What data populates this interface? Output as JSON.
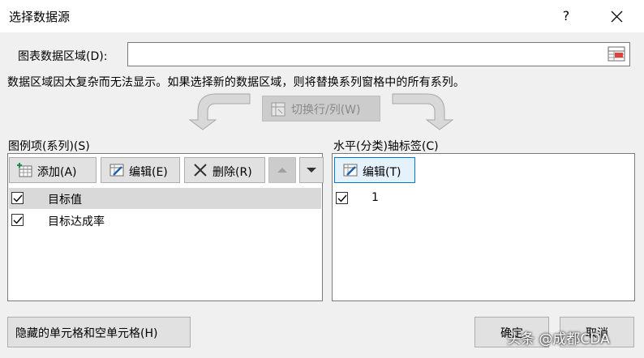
{
  "dialog": {
    "title": "选择数据源",
    "help": "?"
  },
  "range": {
    "label": "图表数据区域(D):",
    "value": ""
  },
  "notice": "数据区域因太复杂而无法显示。如果选择新的数据区域，则将替换系列窗格中的所有系列。",
  "switch_button": "切换行/列(W)",
  "legend": {
    "label": "图例项(系列)(S)",
    "add": "添加(A)",
    "edit": "编辑(E)",
    "delete": "删除(R)",
    "series": [
      {
        "name": "目标值",
        "checked": true,
        "selected": true
      },
      {
        "name": "目标达成率",
        "checked": true,
        "selected": false
      }
    ]
  },
  "axis": {
    "label": "水平(分类)轴标签(C)",
    "edit": "编辑(T)",
    "items": [
      {
        "name": "1",
        "checked": true
      }
    ]
  },
  "buttons": {
    "hidden_cells": "隐藏的单元格和空单元格(H)",
    "ok": "确定",
    "cancel": "取消"
  },
  "watermark": "头条 @成都CDA",
  "colors": {
    "accent": "#0078d7",
    "background": "#f0f0f0",
    "selected_row": "#d9d9d9"
  }
}
